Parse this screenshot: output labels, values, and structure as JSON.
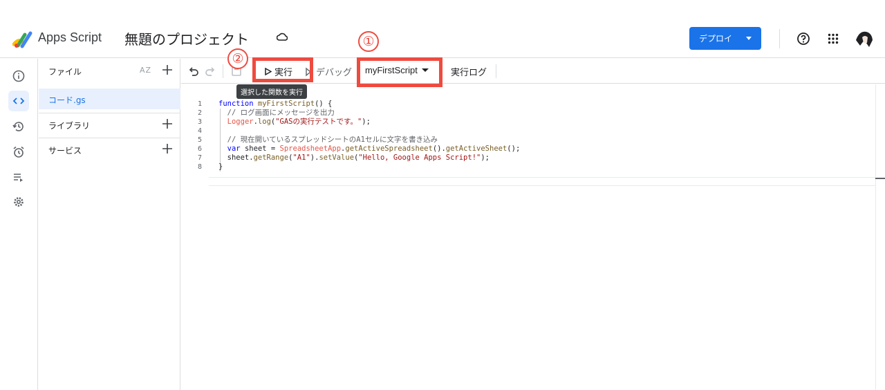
{
  "header": {
    "app_name": "Apps Script",
    "project_title": "無題のプロジェクト",
    "deploy_label": "デプロイ"
  },
  "files_panel": {
    "files_label": "ファイル",
    "sort_label": "AZ",
    "files": [
      {
        "name": "コード.gs"
      }
    ],
    "libraries_label": "ライブラリ",
    "services_label": "サービス"
  },
  "toolbar": {
    "run_label": "実行",
    "debug_label": "デバッグ",
    "function_select": "myFirstScript",
    "log_label": "実行ログ",
    "tooltip": "選択した関数を実行"
  },
  "editor": {
    "line_numbers": [
      "1",
      "2",
      "3",
      "4",
      "5",
      "6",
      "7",
      "8"
    ],
    "lines": [
      "function myFirstScript() {",
      "  // ログ画面にメッセージを出力",
      "  Logger.log(\"GASの実行テストです。\");",
      "",
      "  // 現在開いているスプレッドシートのA1セルに文字を書き込み",
      "  var sheet = SpreadsheetApp.getActiveSpreadsheet().getActiveSheet();",
      "  sheet.getRange(\"A1\").setValue(\"Hello, Google Apps Script!\");",
      "}"
    ]
  },
  "annotations": {
    "marker_1": "①",
    "marker_2": "②"
  },
  "colors": {
    "accent": "#1a73e8",
    "annotation": "#ee4b3f",
    "selected_bg": "#e8f0fe"
  },
  "icons": [
    "apps-script-logo",
    "cloud-sync-icon",
    "help-icon",
    "apps-grid-icon",
    "info-icon",
    "code-icon",
    "history-icon",
    "trigger-icon",
    "executions-icon",
    "settings-icon",
    "undo-icon",
    "redo-icon",
    "save-icon",
    "play-icon",
    "debug-icon",
    "plus-icon"
  ]
}
